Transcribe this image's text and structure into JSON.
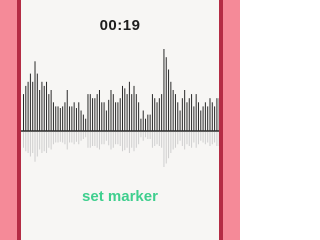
{
  "timer": {
    "elapsed": "00:19"
  },
  "actions": {
    "set_marker_label": "set marker"
  },
  "colors": {
    "accent": "#3fcf8e",
    "frame": "#f58a98",
    "frame_dark": "#b42c44",
    "background": "#f7f6f4",
    "wave": "#2a2a2a",
    "wave_reflection": "#cfcfcf"
  },
  "waveform": {
    "bars": [
      0.45,
      0.55,
      0.6,
      0.7,
      0.6,
      0.85,
      0.7,
      0.5,
      0.6,
      0.55,
      0.6,
      0.45,
      0.5,
      0.35,
      0.3,
      0.3,
      0.28,
      0.3,
      0.35,
      0.5,
      0.3,
      0.3,
      0.35,
      0.28,
      0.35,
      0.25,
      0.2,
      0.15,
      0.45,
      0.45,
      0.4,
      0.4,
      0.45,
      0.5,
      0.35,
      0.35,
      0.25,
      0.38,
      0.5,
      0.45,
      0.35,
      0.35,
      0.4,
      0.55,
      0.52,
      0.45,
      0.6,
      0.45,
      0.55,
      0.45,
      0.35,
      0.15,
      0.25,
      0.15,
      0.2,
      0.2,
      0.45,
      0.4,
      0.35,
      0.4,
      0.45,
      1.0,
      0.9,
      0.75,
      0.6,
      0.5,
      0.45,
      0.35,
      0.25,
      0.4,
      0.5,
      0.35,
      0.4,
      0.45,
      0.3,
      0.45,
      0.35,
      0.25,
      0.3,
      0.35,
      0.3,
      0.4,
      0.35,
      0.3,
      0.4,
      0.4
    ]
  }
}
